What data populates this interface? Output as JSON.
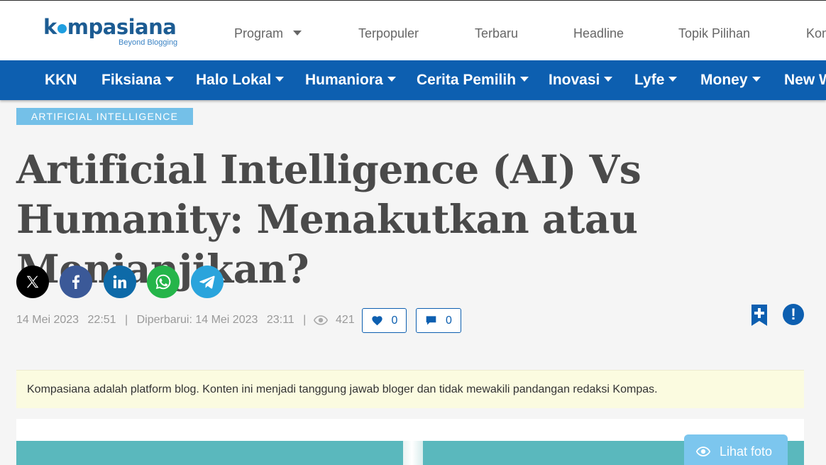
{
  "brand": {
    "name_prefix": "k",
    "name_suffix": "mpasiana",
    "tagline": "Beyond Blogging",
    "color": "#1c5c93"
  },
  "top_nav": [
    {
      "label": "Program",
      "has_dropdown": true
    },
    {
      "label": "Terpopuler"
    },
    {
      "label": "Terbaru"
    },
    {
      "label": "Headline"
    },
    {
      "label": "Topik Pilihan"
    },
    {
      "label": "Kom"
    }
  ],
  "category_nav": [
    {
      "label": "KKN",
      "has_dropdown": false
    },
    {
      "label": "Fiksiana",
      "has_dropdown": true
    },
    {
      "label": "Halo Lokal",
      "has_dropdown": true
    },
    {
      "label": "Humaniora",
      "has_dropdown": true
    },
    {
      "label": "Cerita Pemilih",
      "has_dropdown": true
    },
    {
      "label": "Inovasi",
      "has_dropdown": true
    },
    {
      "label": "Lyfe",
      "has_dropdown": true
    },
    {
      "label": "Money",
      "has_dropdown": true
    },
    {
      "label": "New W",
      "has_dropdown": false
    }
  ],
  "article": {
    "category": "ARTIFICIAL INTELLIGENCE",
    "title": "Artificial Intelligence (AI) Vs Humanity: Menakutkan atau Menjanjikan?",
    "published_date": "14 Mei 2023",
    "published_time": "22:51",
    "separator": "|",
    "updated_label": "Diperbarui: 14 Mei 2023",
    "updated_time": "23:11",
    "views": "421",
    "likes": "0",
    "comments": "0"
  },
  "share_buttons": [
    {
      "name": "x-icon",
      "color": "#000000"
    },
    {
      "name": "facebook-icon",
      "color": "#3b5998"
    },
    {
      "name": "linkedin-icon",
      "color": "#0e6aa8"
    },
    {
      "name": "whatsapp-icon",
      "color": "#25b54a"
    },
    {
      "name": "telegram-icon",
      "color": "#2aa4dc"
    }
  ],
  "disclaimer": "Kompasiana adalah platform blog. Konten ini menjadi tanggung jawab bloger dan tidak mewakili pandangan redaksi Kompas.",
  "photo": {
    "view_label": "Lihat foto"
  },
  "colors": {
    "nav_blue": "#0d5fb0",
    "badge": "#74c0e8",
    "disclaimer_bg": "#fbfbe0"
  }
}
